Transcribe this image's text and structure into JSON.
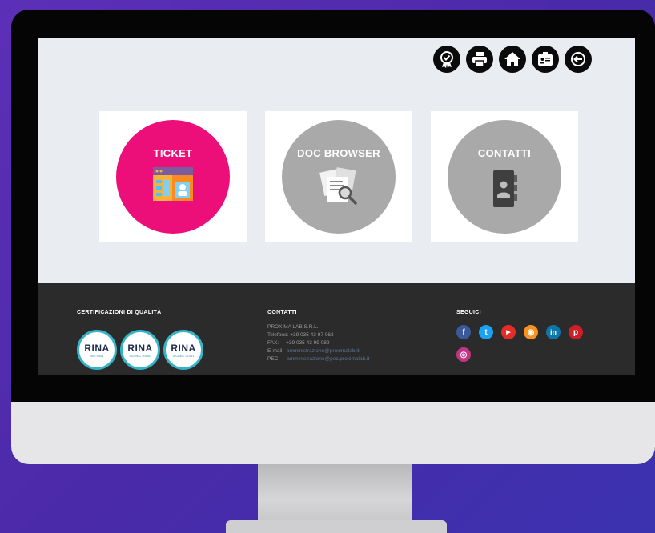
{
  "toolbar": {
    "icons": [
      "quality-badge-icon",
      "printer-icon",
      "home-icon",
      "id-card-icon",
      "logout-icon"
    ]
  },
  "tiles": [
    {
      "label": "TICKET",
      "color": "#ec0f79"
    },
    {
      "label": "DOC BROWSER",
      "color": "#a9a9a9"
    },
    {
      "label": "CONTATTI",
      "color": "#a9a9a9"
    }
  ],
  "footer": {
    "cert": {
      "title": "CERTIFICAZIONI DI QUALITÀ",
      "badges": [
        {
          "name": "RINA",
          "std": "ISO 9001"
        },
        {
          "name": "RINA",
          "std": "ISO/IEC 20000"
        },
        {
          "name": "RINA",
          "std": "ISO/IEC 27001"
        }
      ]
    },
    "contacts": {
      "title": "CONTATTI",
      "company": "PROXIMA LAB S.R.L.",
      "phone_label": "Telefono:",
      "phone": "+39 035 43 97 063",
      "fax_label": "FAX:",
      "fax": "+39 035 43 99 089",
      "email_label": "E-mail:",
      "email": "amministrazione@proximalab.it",
      "pec_label": "PEC:",
      "pec": "amministrazione@pec.proximalab.it"
    },
    "social": {
      "title": "SEGUICI",
      "items": [
        {
          "icon": "facebook-icon",
          "glyph": "f",
          "color": "#3b5998"
        },
        {
          "icon": "twitter-icon",
          "glyph": "t",
          "color": "#1da1f2"
        },
        {
          "icon": "youtube-icon",
          "glyph": "▶",
          "color": "#e52d27"
        },
        {
          "icon": "rss-icon",
          "glyph": "◉",
          "color": "#f7931e"
        },
        {
          "icon": "linkedin-icon",
          "glyph": "in",
          "color": "#0e76a8"
        },
        {
          "icon": "pinterest-icon",
          "glyph": "p",
          "color": "#cb2027"
        },
        {
          "icon": "instagram-icon",
          "glyph": "◎",
          "color": "#c13584"
        }
      ]
    }
  }
}
